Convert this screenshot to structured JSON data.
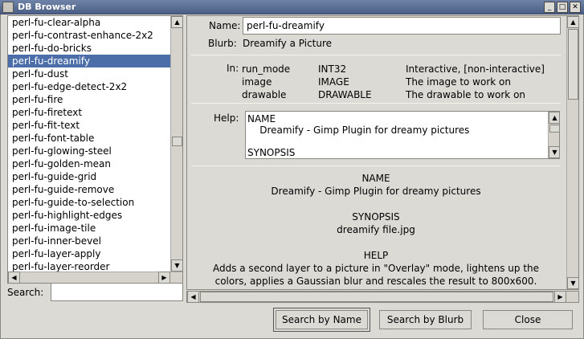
{
  "window": {
    "title": "DB Browser"
  },
  "list": {
    "items": [
      "perl-fu-clear-alpha",
      "perl-fu-contrast-enhance-2x2",
      "perl-fu-do-bricks",
      "perl-fu-dreamify",
      "perl-fu-dust",
      "perl-fu-edge-detect-2x2",
      "perl-fu-fire",
      "perl-fu-firetext",
      "perl-fu-fit-text",
      "perl-fu-font-table",
      "perl-fu-glowing-steel",
      "perl-fu-golden-mean",
      "perl-fu-guide-grid",
      "perl-fu-guide-remove",
      "perl-fu-guide-to-selection",
      "perl-fu-highlight-edges",
      "perl-fu-image-tile",
      "perl-fu-inner-bevel",
      "perl-fu-layer-apply",
      "perl-fu-layer-reorder"
    ],
    "selected_index": 3
  },
  "search": {
    "label": "Search:",
    "value": ""
  },
  "detail": {
    "name_label": "Name:",
    "name_value": "perl-fu-dreamify",
    "blurb_label": "Blurb:",
    "blurb_value": "Dreamify a Picture",
    "in_label": "In:",
    "params": [
      {
        "name": "run_mode",
        "type": "INT32",
        "desc": "Interactive, [non-interactive]"
      },
      {
        "name": "image",
        "type": "IMAGE",
        "desc": "The image to work on"
      },
      {
        "name": "drawable",
        "type": "DRAWABLE",
        "desc": "The drawable to work on"
      }
    ],
    "help_label": "Help:",
    "help_text": "NAME\n    Dreamify - Gimp Plugin for dreamy pictures\n\nSYNOPSIS",
    "doc_lines": [
      "NAME",
      "Dreamify - Gimp Plugin for dreamy pictures",
      "",
      "SYNOPSIS",
      "dreamify file.jpg",
      "",
      "HELP",
      "Adds a second layer to a picture in \"Overlay\" mode, lightens up the",
      "colors, applies a Gaussian blur and rescales the result to 800x600."
    ]
  },
  "buttons": {
    "search_by_name": "Search by Name",
    "search_by_blurb": "Search by Blurb",
    "close": "Close"
  }
}
